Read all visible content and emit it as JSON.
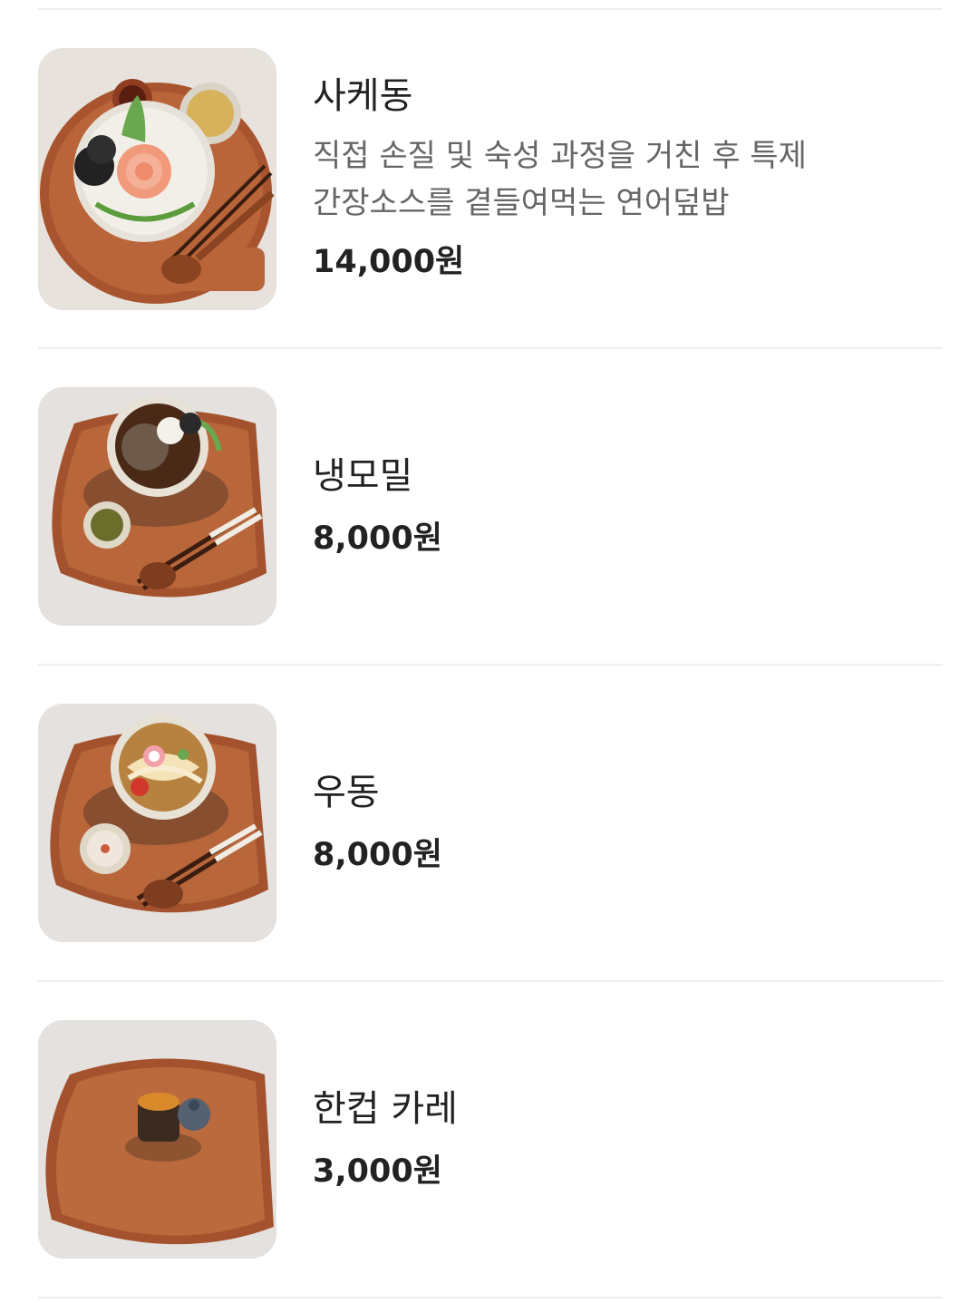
{
  "menu": {
    "items": [
      {
        "name": "사케동",
        "description": "직접 손질 및 숙성 과정을 거친 후 특제 간장소스를 곁들여먹는 연어덮밥",
        "price": "14,000원",
        "image_icon": "salmon-rice-bowl-photo"
      },
      {
        "name": "냉모밀",
        "price": "8,000원",
        "image_icon": "cold-soba-photo"
      },
      {
        "name": "우동",
        "price": "8,000원",
        "image_icon": "udon-photo"
      },
      {
        "name": "한컵 카레",
        "price": "3,000원",
        "image_icon": "curry-cup-photo"
      }
    ]
  },
  "colors": {
    "tray": "#b5623a",
    "divider": "#eeeeee",
    "text_primary": "#222222",
    "text_secondary": "#666666"
  }
}
